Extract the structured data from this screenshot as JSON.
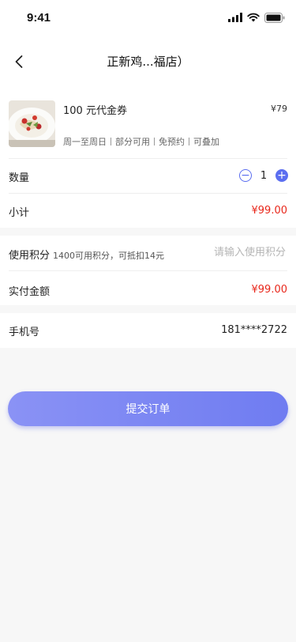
{
  "status_bar": {
    "time": "9:41"
  },
  "nav": {
    "title": "正新鸡...福店）"
  },
  "product": {
    "name": "100 元代金券",
    "price": "¥79",
    "tags": [
      "周一至周日",
      "部分可用",
      "免预约",
      "可叠加"
    ]
  },
  "quantity": {
    "label": "数量",
    "count": "1",
    "minus": "−",
    "plus": "+"
  },
  "subtotal": {
    "label": "小计",
    "value": "¥99.00"
  },
  "points": {
    "label": "使用积分",
    "hint": "1400可用积分，可抵扣14元",
    "placeholder": "请输入使用积分"
  },
  "actual": {
    "label": "实付金额",
    "value": "¥99.00"
  },
  "phone": {
    "label": "手机号",
    "value": "181****2722"
  },
  "submit": {
    "label": "提交订单"
  },
  "colors": {
    "accent": "#5b6ef0",
    "price_red": "#e8271b",
    "background": "#f7f7f7"
  }
}
